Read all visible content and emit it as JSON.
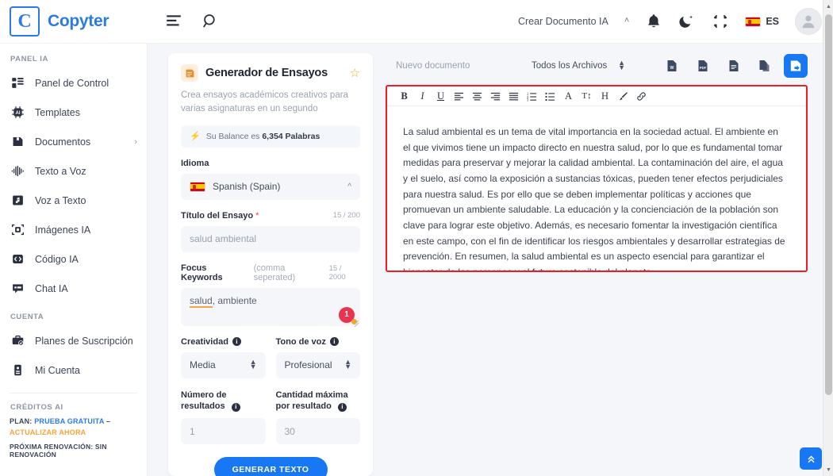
{
  "brand": {
    "initial": "C",
    "name": "Copyter"
  },
  "topbar": {
    "menu_icon": "menu-icon",
    "search_icon": "search-icon",
    "create_doc_label": "Crear Documento IA",
    "chevron": "˄",
    "bell_icon": "bell-icon",
    "theme_icon": "moon-icon",
    "fullscreen_icon": "compress-icon",
    "lang_code": "ES"
  },
  "sidebar": {
    "section_panel": "PANEL IA",
    "items": [
      {
        "label": "Panel de Control",
        "icon": "dashboard-icon",
        "caret": ""
      },
      {
        "label": "Templates",
        "icon": "ai-chip-icon",
        "caret": ""
      },
      {
        "label": "Documentos",
        "icon": "documents-icon",
        "caret": "›"
      },
      {
        "label": "Texto a Voz",
        "icon": "waveform-icon",
        "caret": ""
      },
      {
        "label": "Voz a Texto",
        "icon": "audio-file-icon",
        "caret": ""
      },
      {
        "label": "Imágenes IA",
        "icon": "image-ai-icon",
        "caret": ""
      },
      {
        "label": "Código IA",
        "icon": "code-icon",
        "caret": ""
      },
      {
        "label": "Chat IA",
        "icon": "chat-icon",
        "caret": ""
      }
    ],
    "section_account": "CUENTA",
    "account_items": [
      {
        "label": "Planes de Suscripción",
        "icon": "briefcase-check-icon"
      },
      {
        "label": "Mi Cuenta",
        "icon": "id-card-icon"
      }
    ],
    "section_credits": "CRÉDITOS AI",
    "plan_prefix": "PLAN:",
    "plan_value": "PRUEBA GRATUITA",
    "plan_dash": "–",
    "plan_upgrade": "ACTUALIZAR AHORA",
    "renewal": "PRÓXIMA RENOVACIÓN: SIN RENOVACIÓN"
  },
  "form": {
    "icon": "essay-icon",
    "title": "Generador de Ensayos",
    "star_icon": "star-outline-icon",
    "description": "Crea ensayos académicos creativos para varias asignaturas en un segundo",
    "balance_bolt": "⚡",
    "balance_prefix": "Su Balance es ",
    "balance_value": "6,354 Palabras",
    "language_label": "Idioma",
    "language_value": "Spanish (Spain)",
    "title_label": "Título del Ensayo",
    "title_required": "*",
    "title_counter": "15 / 200",
    "title_value": "salud ambiental",
    "keywords_label": "Focus Keywords",
    "keywords_sub": "(comma seperated)",
    "keywords_counter": "15 / 2000",
    "keywords_underlined": "salud",
    "keywords_rest": ", ambiente",
    "grammar_badge_count": "1",
    "creativity_label": "Creatividad",
    "creativity_value": "Media",
    "tone_label": "Tono de voz",
    "tone_value": "Profesional",
    "results_label": "Número de resultados",
    "results_value": "1",
    "maxqty_label": "Cantidad máxima por resultado",
    "maxqty_value": "30",
    "generate_button": "GENERAR TEXTO"
  },
  "editor": {
    "doc_name_placeholder": "Nuevo documento",
    "filter_value": "Todos los Archivos",
    "export_word": "word-export-icon",
    "export_pdf": "pdf-export-icon",
    "export_txt": "text-export-icon",
    "copy_icon": "copy-icon",
    "save_icon": "save-document-icon",
    "toolbar": [
      {
        "label": "B",
        "name": "bold-icon"
      },
      {
        "label": "I",
        "name": "italic-icon"
      },
      {
        "label": "U",
        "name": "underline-icon"
      },
      {
        "label": "",
        "name": "align-left-icon"
      },
      {
        "label": "",
        "name": "align-center-icon"
      },
      {
        "label": "",
        "name": "align-right-icon"
      },
      {
        "label": "",
        "name": "align-justify-icon"
      },
      {
        "label": "",
        "name": "ordered-list-icon"
      },
      {
        "label": "",
        "name": "unordered-list-icon"
      },
      {
        "label": "A",
        "name": "font-color-icon"
      },
      {
        "label": "T↕",
        "name": "font-size-icon"
      },
      {
        "label": "H",
        "name": "heading-icon"
      },
      {
        "label": "",
        "name": "brush-icon"
      },
      {
        "label": "",
        "name": "link-icon"
      }
    ],
    "document_text": "La salud ambiental es un tema de vital importancia en la sociedad actual. El ambiente en el que vivimos tiene un impacto directo en nuestra salud, por lo que es fundamental tomar medidas para preservar y mejorar la calidad ambiental. La contaminación del aire, el agua y el suelo, así como la exposición a sustancias tóxicas, pueden tener efectos perjudiciales para nuestra salud. Es por ello que se deben implementar políticas y acciones que promuevan un ambiente saludable. La educación y la concienciación de la población son clave para lograr este objetivo. Además, es necesario fomentar la investigación científica en este campo, con el fin de identificar los riesgos ambientales y desarrollar estrategias de prevención. En resumen, la salud ambiental es un aspecto esencial para garantizar el bienestar de las personas y el futuro sostenible del planeta.",
    "scroll_top_icon": "double-chevron-up-icon"
  },
  "colors": {
    "brand_blue": "#2c7be5",
    "action_blue": "#1877f2",
    "highlight_red": "#ee1c25",
    "accent_orange": "#f6a33a",
    "badge_red": "#e8344e"
  }
}
